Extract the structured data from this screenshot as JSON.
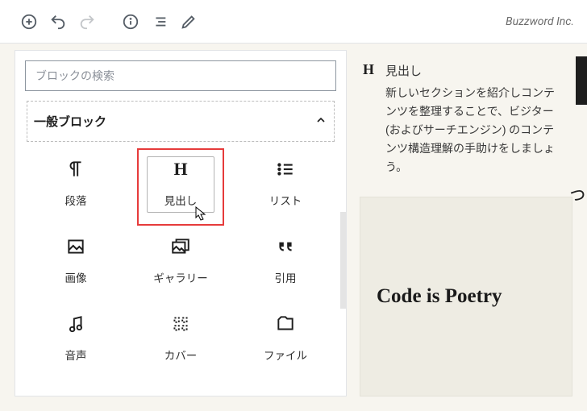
{
  "brand": "Buzzword Inc.",
  "search": {
    "placeholder": "ブロックの検索"
  },
  "section": {
    "title": "一般ブロック"
  },
  "blocks": {
    "paragraph": "段落",
    "heading": "見出し",
    "list": "リスト",
    "image": "画像",
    "gallery": "ギャラリー",
    "quote": "引用",
    "audio": "音声",
    "cover": "カバー",
    "file": "ファイル"
  },
  "hint": {
    "icon": "H",
    "title": "見出し",
    "desc": "新しいセクションを紹介しコンテンツを整理することで、ビジター (およびサーチエンジン) のコンテンツ構造理解の手助けをしましょう。"
  },
  "content": {
    "heading_text": "Code is Poetry"
  },
  "edge_fragment": "っ"
}
